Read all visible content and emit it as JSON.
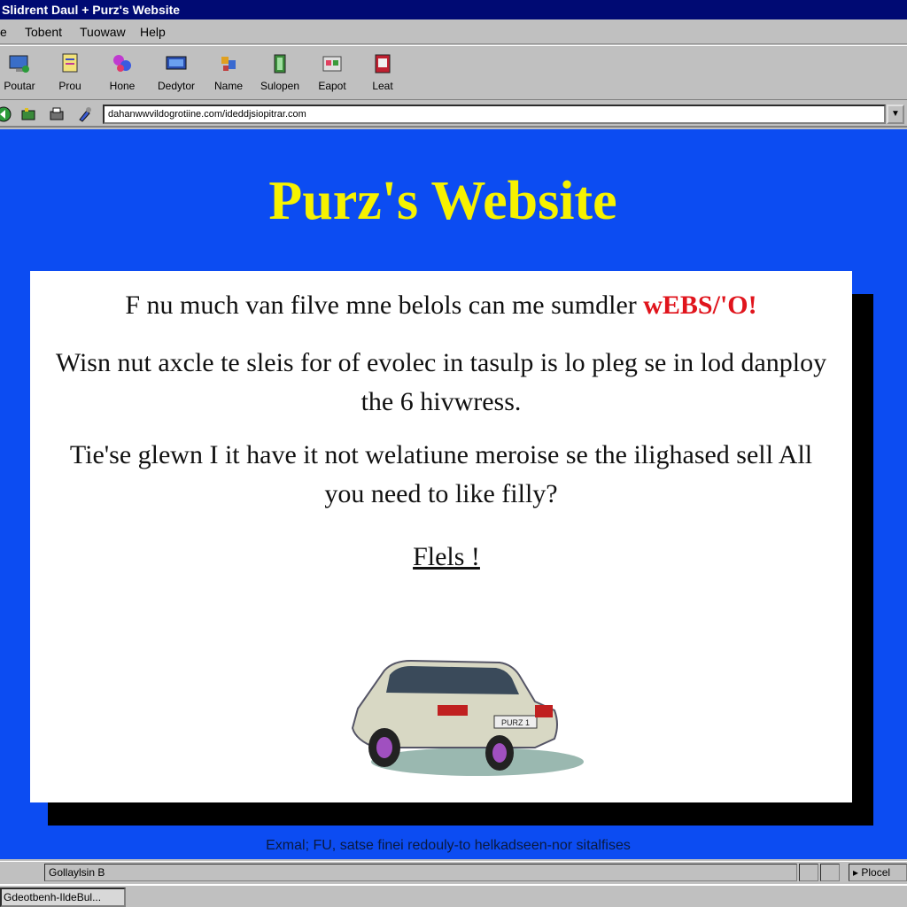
{
  "window": {
    "title": "Slidrent Daul + Purz's Website"
  },
  "menu": {
    "items": [
      "e",
      "Tobent",
      "Tuowaw",
      "Help"
    ]
  },
  "toolbar": {
    "buttons": [
      "Poutar",
      "Prou",
      "Hone",
      "Dedytor",
      "Name",
      "Sulopen",
      "Eapot",
      "Leat"
    ]
  },
  "address": {
    "url": "dahanwwvildogrotiine.com/ideddjsiopitrar.com"
  },
  "page": {
    "title": "Purz's Website",
    "intro": "F nu much van filve mne belols can me sumdler ",
    "intro_highlight": "wEBS/'O!",
    "para2": "Wisn nut axcle te sleis for of evolec in tasulp is lo pleg se in lod danploy the 6 hivwress.",
    "para3": "Tie'se glewn I it have it not welatiune meroise se the ilighased sell All you need to like filly?",
    "link": "Flels !",
    "car_plate": "PURZ 1",
    "footer": "Exmal; FU, satse finei redouly-to helkadseen-nor sitalfises"
  },
  "status": {
    "left": "Gollaylsin B",
    "right": "Plocel"
  },
  "taskbar": {
    "item": "Gdeotbenh-IldeBul..."
  },
  "colors": {
    "viewport_bg": "#0c4cf2",
    "title_color": "#f6f200",
    "highlight": "#e0141c"
  }
}
